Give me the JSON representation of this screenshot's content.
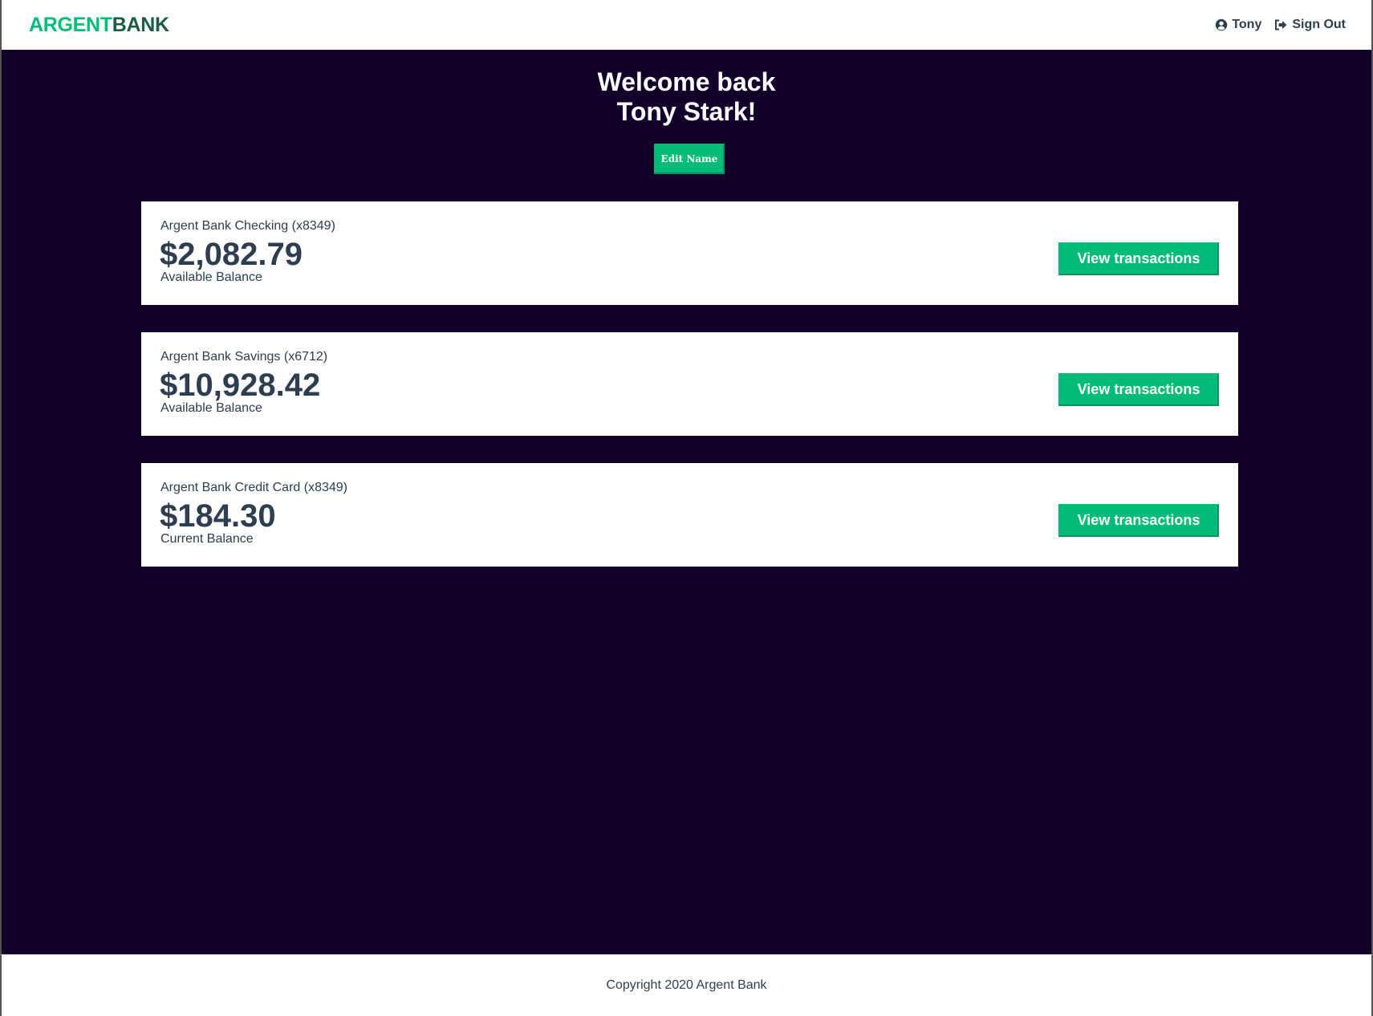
{
  "nav": {
    "logo_part1": "ARGENT",
    "logo_part2": "BANK",
    "user_label": "Tony",
    "user_icon": "user-circle-icon",
    "signout_label": "Sign Out",
    "signout_icon": "sign-out-icon"
  },
  "header": {
    "greeting_line1": "Welcome back",
    "greeting_line2": "Tony Stark!",
    "edit_button": "Edit Name"
  },
  "accounts": [
    {
      "title": "Argent Bank Checking (x8349)",
      "amount": "$2,082.79",
      "description": "Available Balance",
      "button": "View transactions"
    },
    {
      "title": "Argent Bank Savings (x6712)",
      "amount": "$10,928.42",
      "description": "Available Balance",
      "button": "View transactions"
    },
    {
      "title": "Argent Bank Credit Card (x8349)",
      "amount": "$184.30",
      "description": "Current Balance",
      "button": "View transactions"
    }
  ],
  "footer": {
    "copyright": "Copyright 2020 Argent Bank"
  },
  "colors": {
    "accent": "#00bc77",
    "background": "#12002b",
    "text": "#2c3e50"
  }
}
